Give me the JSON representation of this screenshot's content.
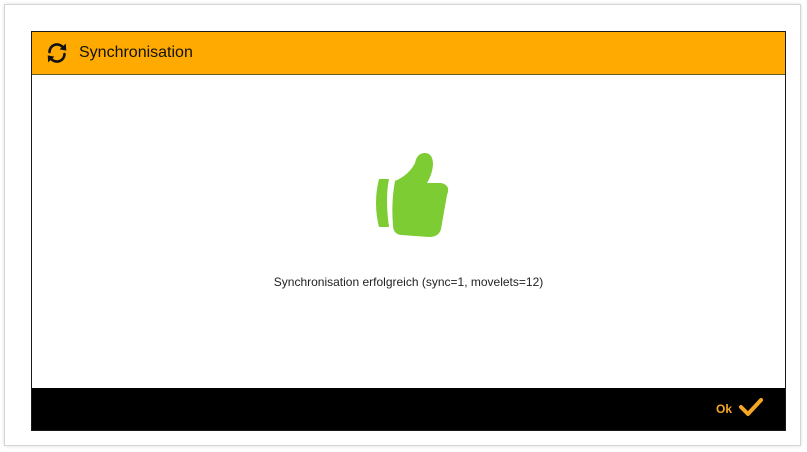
{
  "dialog": {
    "title": "Synchronisation",
    "header_icon": "sync-icon",
    "message": "Synchronisation erfolgreich (sync=1, movelets=12)",
    "status_icon": "thumbs-up-icon",
    "ok_label": "Ok",
    "ok_icon": "check-icon"
  },
  "colors": {
    "header_bg": "#FFAA00",
    "footer_bg": "#000000",
    "thumb": "#7DCC33",
    "accent": "#F5A623"
  }
}
